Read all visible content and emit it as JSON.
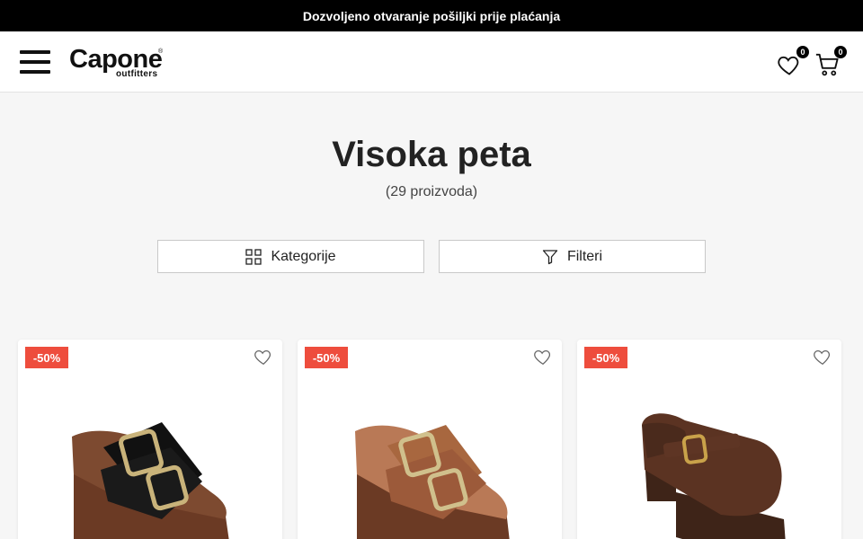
{
  "announcement": "Dozvoljeno otvaranje pošiljki prije plaćanja",
  "header": {
    "logo_main": "Capone",
    "logo_sub": "outfitters",
    "logo_reg": "®",
    "wishlist_count": "0",
    "cart_count": "0"
  },
  "page": {
    "title": "Visoka peta",
    "count": "(29 proizvoda)"
  },
  "buttons": {
    "categories": "Kategorije",
    "filters": "Filteri"
  },
  "products": [
    {
      "discount": "-50%",
      "color": "#1a1a1a"
    },
    {
      "discount": "-50%",
      "color": "#9c5a3a"
    },
    {
      "discount": "-50%",
      "color": "#5b3322"
    }
  ],
  "colors": {
    "sale_badge": "#ee4d3d",
    "topbar": "#000000",
    "heel_wood": "#6b3a24"
  },
  "icons": [
    "menu-icon",
    "heart-icon",
    "cart-icon",
    "grid-icon",
    "filter-icon"
  ]
}
